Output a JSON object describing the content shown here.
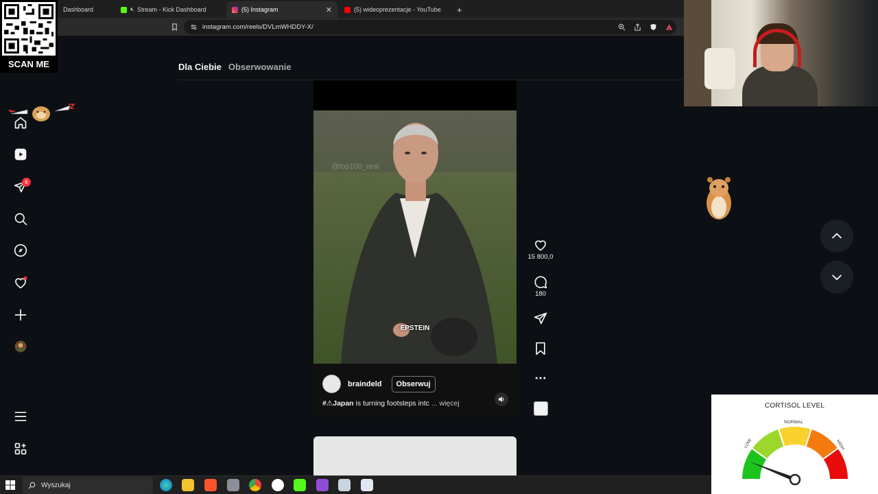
{
  "browser": {
    "tabs": [
      {
        "title": "Dashboard",
        "favicon_color": "#1f1f1f",
        "active": false
      },
      {
        "title": "Stream - Kick Dashboard",
        "favicon_color": "#53fc18",
        "active": false
      },
      {
        "title": "(5) Instagram",
        "favicon_color": "#e1306c",
        "active": true
      },
      {
        "title": "(5) wideoprezentacje - YouTube",
        "favicon_color": "#ff0000",
        "active": false
      }
    ],
    "new_tab": "+",
    "url": "instagram.com/reels/DVLmWHDDY-X/"
  },
  "overlay": {
    "scan_me": "SCAN ME"
  },
  "sidebar": {
    "items": [
      {
        "name": "home"
      },
      {
        "name": "reels"
      },
      {
        "name": "messages",
        "badge": "6"
      },
      {
        "name": "search"
      },
      {
        "name": "explore"
      },
      {
        "name": "notifications"
      },
      {
        "name": "create"
      },
      {
        "name": "profile"
      },
      {
        "name": "more"
      },
      {
        "name": "also-from-meta"
      }
    ]
  },
  "feed": {
    "tabs": [
      "Dla Ciebie",
      "Obserwowanie"
    ]
  },
  "reel": {
    "overlay_caption": "EPSTEIN",
    "watermark": "@top100_real",
    "author": "braindeld",
    "follow_label": "Obserwuj",
    "caption_tag": "#⚠Japan",
    "caption_text": " is turning footsteps intc",
    "caption_more": "... więcej",
    "likes": "15 800,0",
    "comments": "180"
  },
  "cortisol": {
    "title": "CORTISOL LEVEL",
    "labels": {
      "low": "LOW",
      "normal": "NORMAL",
      "high": "HIGH"
    },
    "level": 0.12,
    "colors": [
      "#1ec41e",
      "#9cd82b",
      "#f8d12d",
      "#f57a0d",
      "#e80b0b"
    ]
  },
  "taskbar": {
    "search_placeholder": "Wyszukaj"
  }
}
